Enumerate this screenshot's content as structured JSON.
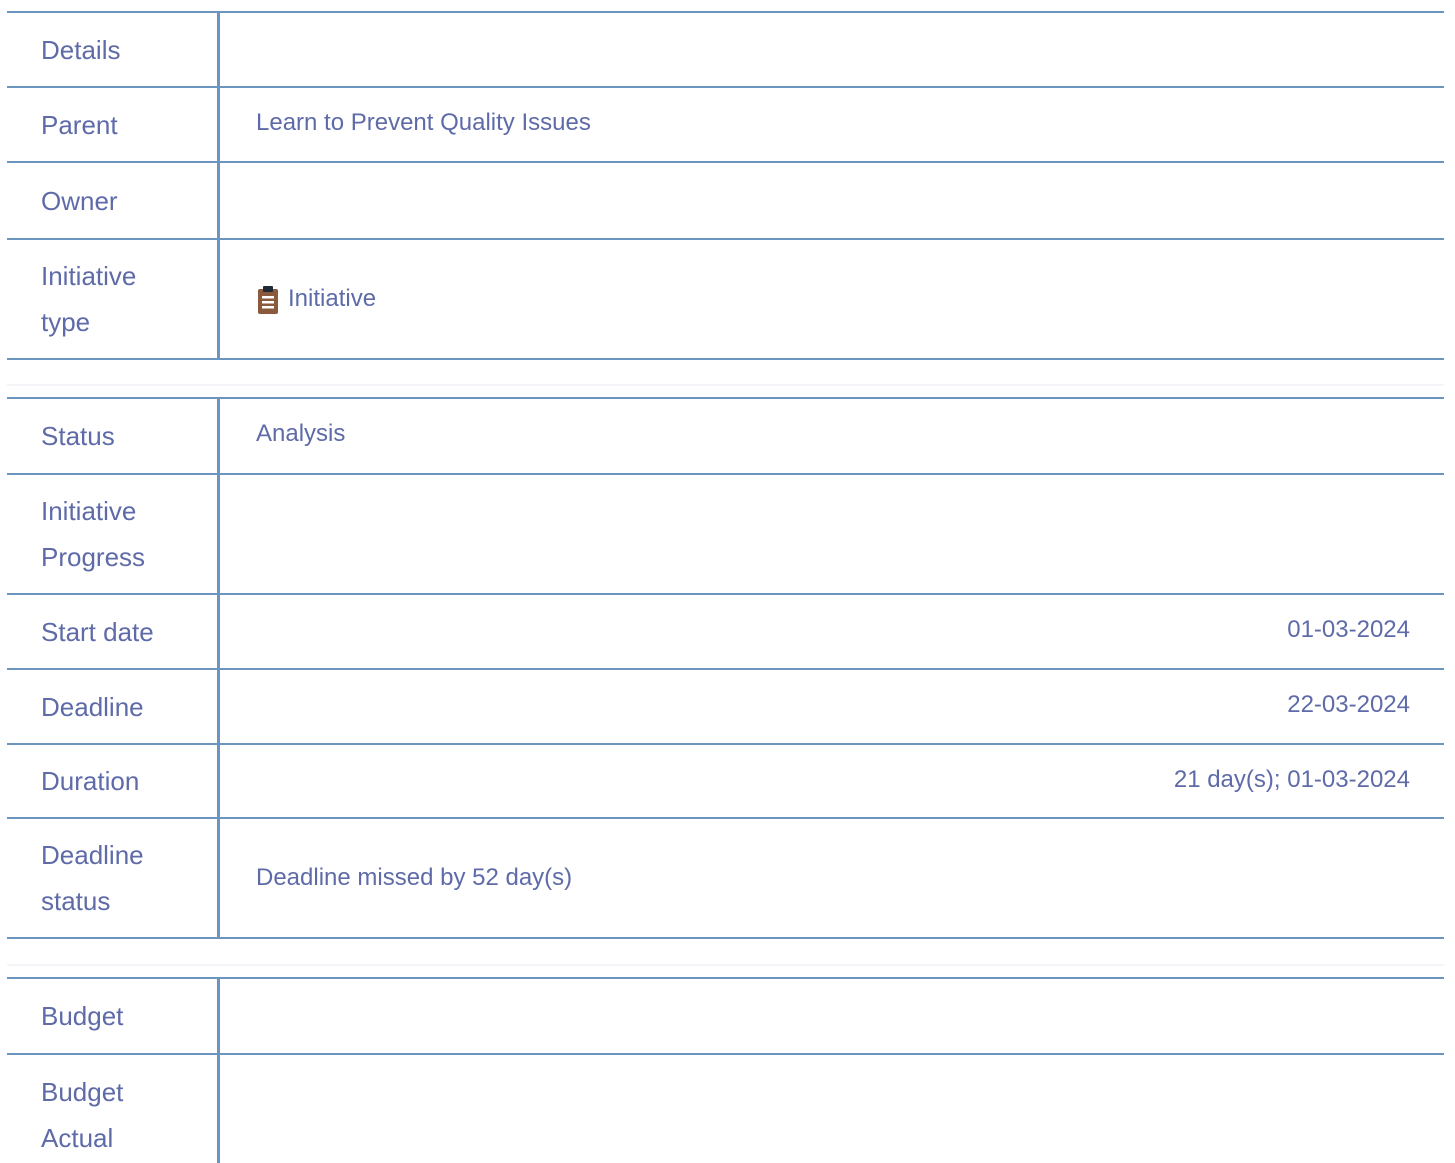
{
  "sections": {
    "general": {
      "details_label": "Details",
      "parent_label": "Parent",
      "parent_value": "Learn to Prevent Quality Issues",
      "owner_label": "Owner",
      "initiative_type_label": "Initiative type",
      "initiative_type_value": "Initiative",
      "initiative_type_icon": "clipboard-icon"
    },
    "progress": {
      "status_label": "Status",
      "status_value": "Analysis",
      "initiative_progress_label": "Initiative Progress",
      "start_date_label": "Start date",
      "start_date_value": "01-03-2024",
      "deadline_label": "Deadline",
      "deadline_value": "22-03-2024",
      "duration_label": "Duration",
      "duration_value": "21 day(s); 01-03-2024",
      "deadline_status_label": "Deadline status",
      "deadline_status_value": "Deadline missed by 52 day(s)"
    },
    "budget": {
      "budget_label": "Budget",
      "budget_actual_label": "Budget Actual"
    }
  },
  "colors": {
    "border": "#6b95bf",
    "text": "#5e6ba8",
    "icon": "#8b5a3c"
  }
}
